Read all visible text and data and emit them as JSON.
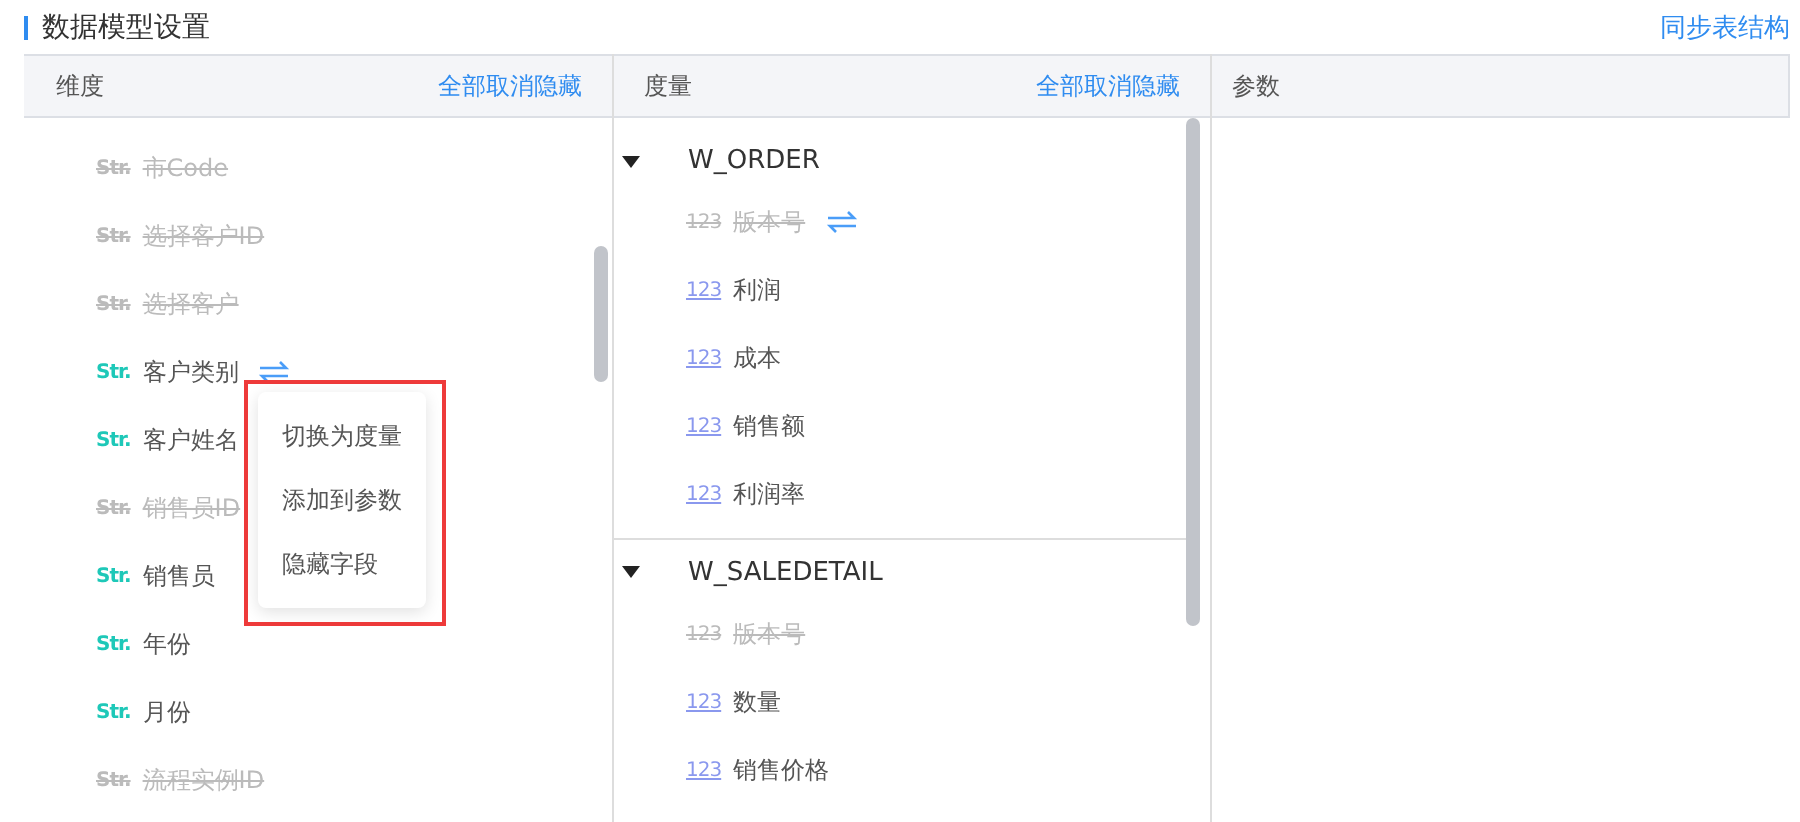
{
  "title": "数据模型设置",
  "sync_link": "同步表结构",
  "dimensions": {
    "heading": "维度",
    "unhide_all": "全部取消隐藏",
    "items": [
      {
        "type": "Str.",
        "name": "市Code",
        "hidden": true,
        "switch_icon": false
      },
      {
        "type": "Str.",
        "name": "选择客户ID",
        "hidden": true,
        "switch_icon": false
      },
      {
        "type": "Str.",
        "name": "选择客户",
        "hidden": true,
        "switch_icon": false
      },
      {
        "type": "Str.",
        "name": "客户类别",
        "hidden": false,
        "switch_icon": true
      },
      {
        "type": "Str.",
        "name": "客户姓名",
        "hidden": false,
        "switch_icon": false
      },
      {
        "type": "Str.",
        "name": "销售员ID",
        "hidden": true,
        "switch_icon": false
      },
      {
        "type": "Str.",
        "name": "销售员",
        "hidden": false,
        "switch_icon": false
      },
      {
        "type": "Str.",
        "name": "年份",
        "hidden": false,
        "switch_icon": false
      },
      {
        "type": "Str.",
        "name": "月份",
        "hidden": false,
        "switch_icon": false
      },
      {
        "type": "Str.",
        "name": "流程实例ID",
        "hidden": true,
        "switch_icon": false
      }
    ]
  },
  "measures": {
    "heading": "度量",
    "unhide_all": "全部取消隐藏",
    "groups": [
      {
        "name": "W_ORDER",
        "expanded": true,
        "children": [
          {
            "type": "123",
            "name": "版本号",
            "hidden": true,
            "switch_icon": true
          },
          {
            "type": "123",
            "name": "利润",
            "hidden": false,
            "switch_icon": false
          },
          {
            "type": "123",
            "name": "成本",
            "hidden": false,
            "switch_icon": false
          },
          {
            "type": "123",
            "name": "销售额",
            "hidden": false,
            "switch_icon": false
          },
          {
            "type": "123",
            "name": "利润率",
            "hidden": false,
            "switch_icon": false
          }
        ]
      },
      {
        "name": "W_SALEDETAIL",
        "expanded": true,
        "children": [
          {
            "type": "123",
            "name": "版本号",
            "hidden": true,
            "switch_icon": false
          },
          {
            "type": "123",
            "name": "数量",
            "hidden": false,
            "switch_icon": false
          },
          {
            "type": "123",
            "name": "销售价格",
            "hidden": false,
            "switch_icon": false
          }
        ]
      }
    ]
  },
  "parameters": {
    "heading": "参数"
  },
  "context_menu": {
    "items": [
      "切换为度量",
      "添加到参数",
      "隐藏字段"
    ]
  }
}
